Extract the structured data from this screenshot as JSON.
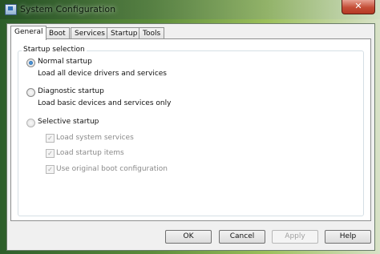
{
  "window": {
    "title": "System Configuration",
    "icon": "system-config-icon",
    "close_label": "✕"
  },
  "tabs": [
    {
      "label": "General",
      "active": true
    },
    {
      "label": "Boot"
    },
    {
      "label": "Services"
    },
    {
      "label": "Startup"
    },
    {
      "label": "Tools"
    }
  ],
  "startup_selection": {
    "label": "Startup selection",
    "options": [
      {
        "label": "Normal startup",
        "description": "Load all device drivers and services",
        "selected": true
      },
      {
        "label": "Diagnostic startup",
        "description": "Load basic devices and services only",
        "selected": false
      },
      {
        "label": "Selective startup",
        "selected": false
      }
    ],
    "checkboxes": [
      {
        "label": "Load system services",
        "checked": true,
        "enabled": false
      },
      {
        "label": "Load startup items",
        "checked": true,
        "enabled": false
      },
      {
        "label": "Use original boot configuration",
        "checked": true,
        "enabled": false
      }
    ]
  },
  "buttons": {
    "ok": "OK",
    "cancel": "Cancel",
    "apply": "Apply",
    "help": "Help"
  },
  "colors": {
    "accent": "#17589c",
    "close_button": "#c44e37"
  }
}
